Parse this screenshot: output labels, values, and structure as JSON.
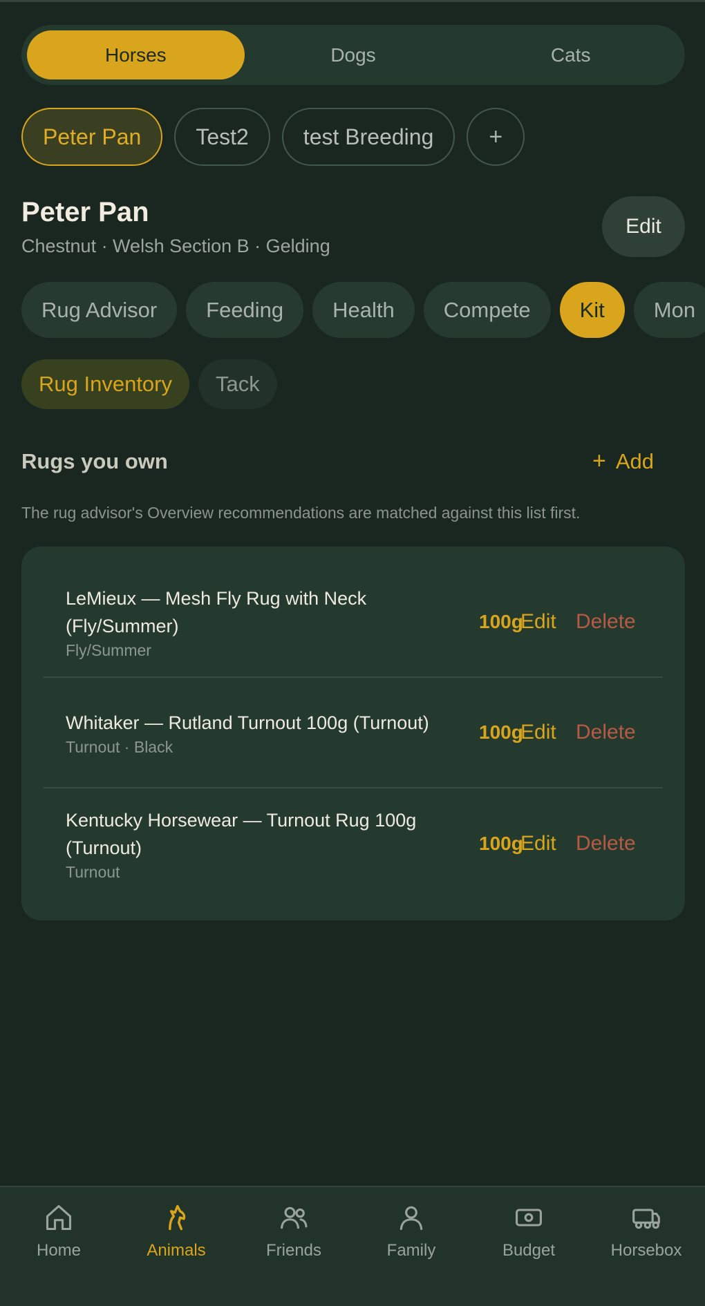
{
  "species_tabs": [
    {
      "label": "Horses",
      "active": true
    },
    {
      "label": "Dogs",
      "active": false
    },
    {
      "label": "Cats",
      "active": false
    }
  ],
  "animals": [
    {
      "label": "Peter Pan",
      "active": true
    },
    {
      "label": "Test2",
      "active": false
    },
    {
      "label": "test Breeding",
      "active": false
    }
  ],
  "add_animal_label": "+",
  "profile": {
    "name": "Peter Pan",
    "details": "Chestnut · Welsh Section B · Gelding",
    "edit_label": "Edit"
  },
  "section_tabs": [
    "Rug Advisor",
    "Feeding",
    "Health",
    "Compete",
    "Kit",
    "Mon"
  ],
  "active_section_tab": "Kit",
  "sub_tabs": [
    "Rug Inventory",
    "Tack"
  ],
  "active_sub_tab": "Rug Inventory",
  "rugs_section": {
    "title": "Rugs you own",
    "add_icon": "+",
    "add_label": "Add",
    "info": "The rug advisor's Overview recommendations are matched against this list first."
  },
  "rugs": [
    {
      "name": "LeMieux — Mesh Fly Rug with Neck (Fly/Summer)",
      "meta": "Fly/Summer",
      "weight": "100g",
      "edit": "Edit",
      "delete": "Delete"
    },
    {
      "name": "Whitaker — Rutland Turnout 100g (Turnout)",
      "meta": "Turnout · Black",
      "weight": "100g",
      "edit": "Edit",
      "delete": "Delete"
    },
    {
      "name": "Kentucky Horsewear — Turnout Rug 100g (Turnout)",
      "meta": "Turnout",
      "weight": "100g",
      "edit": "Edit",
      "delete": "Delete"
    }
  ],
  "bottom_nav": [
    {
      "label": "Home",
      "icon": "home-icon",
      "active": false
    },
    {
      "label": "Animals",
      "icon": "horse-icon",
      "active": true
    },
    {
      "label": "Friends",
      "icon": "friends-icon",
      "active": false
    },
    {
      "label": "Family",
      "icon": "person-icon",
      "active": false
    },
    {
      "label": "Budget",
      "icon": "money-icon",
      "active": false
    },
    {
      "label": "Horsebox",
      "icon": "horsebox-icon",
      "active": false
    }
  ],
  "colors": {
    "background": "#1a2620",
    "accent": "#d8a51c",
    "danger": "#b65a44",
    "card": "#253a2f"
  }
}
